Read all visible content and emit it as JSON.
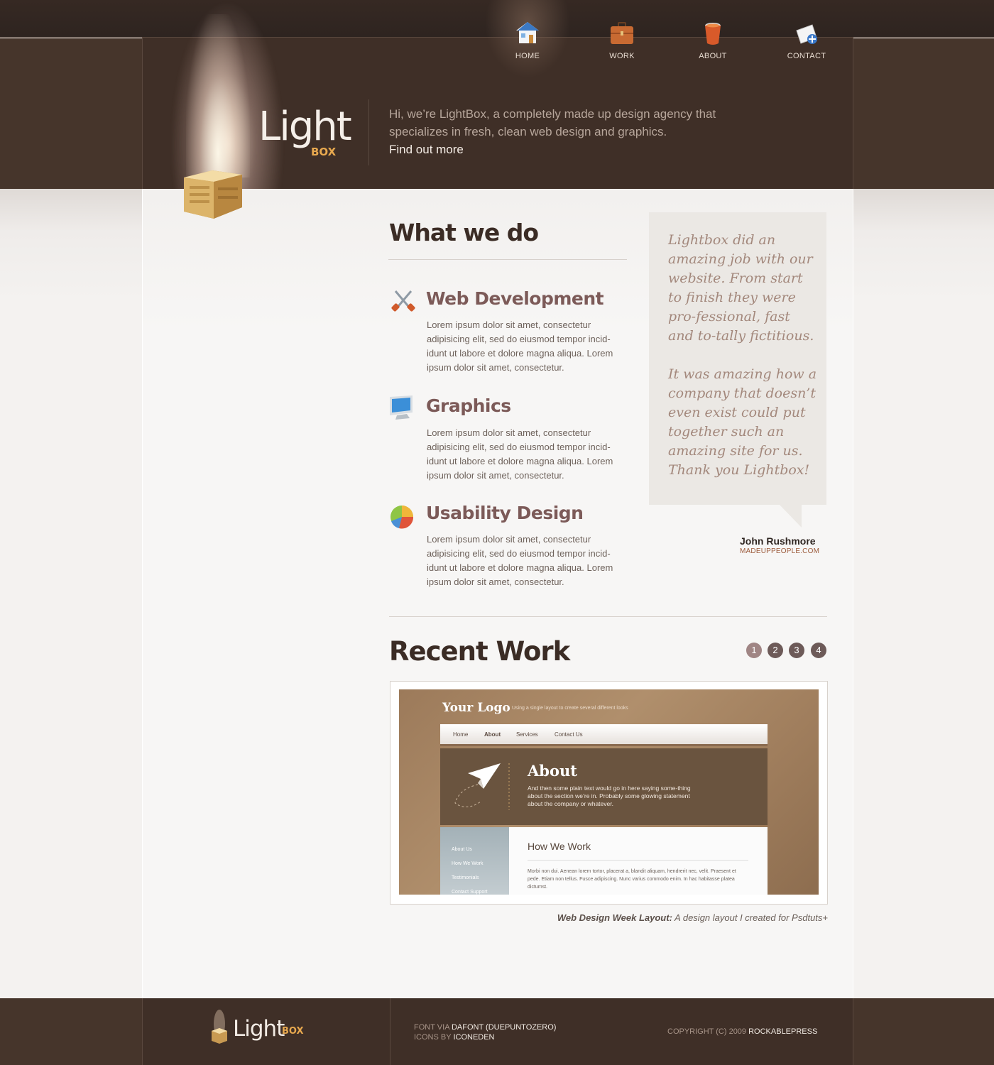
{
  "colors": {
    "header_bg": "#3f2f27",
    "accent_orange": "#e8a94f",
    "service_title": "#7c5a58",
    "quote_text": "#a3887c"
  },
  "nav": {
    "items": [
      {
        "label": "HOME",
        "icon": "house-icon"
      },
      {
        "label": "WORK",
        "icon": "briefcase-icon"
      },
      {
        "label": "ABOUT",
        "icon": "paint-bucket-icon"
      },
      {
        "label": "CONTACT",
        "icon": "mail-add-icon"
      }
    ]
  },
  "logo": {
    "light": "Light",
    "box": "BOX"
  },
  "intro": {
    "text": "Hi, we’re LightBox, a completely made up design agency that specializes in fresh, clean web design and graphics.",
    "link": "Find out more"
  },
  "what_we_do": {
    "title": "What we do",
    "services": [
      {
        "icon": "tools-icon",
        "title": "Web Development",
        "text": "Lorem ipsum dolor sit amet, consectetur adipisicing elit, sed do eiusmod tempor incid-idunt ut labore et dolore magna aliqua. Lorem ipsum dolor sit amet, consectetur."
      },
      {
        "icon": "monitor-icon",
        "title": "Graphics",
        "text": "Lorem ipsum dolor sit amet, consectetur adipisicing elit, sed do eiusmod tempor incid-idunt ut labore et dolore magna aliqua. Lorem ipsum dolor sit amet, consectetur."
      },
      {
        "icon": "pie-chart-icon",
        "title": "Usability Design",
        "text": "Lorem ipsum dolor sit amet, consectetur adipisicing elit, sed do eiusmod tempor incid-idunt ut labore et dolore magna aliqua. Lorem ipsum dolor sit amet, consectetur."
      }
    ]
  },
  "testimonial": {
    "p1": "Lightbox did an amazing job with our website. From start to finish they were pro-fessional, fast and to-tally fictitious.",
    "p2": "It was amazing how a company that doesn’t even exist could put together such an amazing site for us. Thank you Lightbox!",
    "author": "John Rushmore",
    "site": "MADEUPPEOPLE.COM"
  },
  "recent_work": {
    "title": "Recent Work",
    "pages": [
      "1",
      "2",
      "3",
      "4"
    ],
    "active_page": "1",
    "caption_bold": "Web Design Week Layout:",
    "caption_text": " A design layout I created for Psdtuts+",
    "preview": {
      "logo": "Your Logo",
      "tagline": "Using a single layout to create several different looks",
      "nav": [
        "Home",
        "About",
        "Services",
        "Contact Us"
      ],
      "hero_title": "About",
      "hero_text": "And then some plain text would go in here saying some-thing about the section we’re in.  Probably some glowing statement about the company or whatever.",
      "side_items": [
        "About Us",
        "How We Work",
        "Testimonials",
        "Contact Support"
      ],
      "content_title": "How We Work",
      "content_text": "Morbi non dui. Aenean lorem tortor, placerat a, blandit aliquam, hendrerit nec, velit. Praesent et pede. Etiam non tellus. Fusce adipiscing. Nunc varius commodo enim. In hac habitasse platea dictumst."
    }
  },
  "footer": {
    "logo_light": "Light",
    "logo_box": "BOX",
    "font_prefix": "FONT VIA ",
    "font_credit": "DAFONT (DUEPUNTOZERO)",
    "icons_prefix": "ICONS BY ",
    "icons_credit": "ICONEDEN",
    "copyright_prefix": "COPYRIGHT (C) 2009 ",
    "copyright_owner": "ROCKABLEPRESS"
  }
}
